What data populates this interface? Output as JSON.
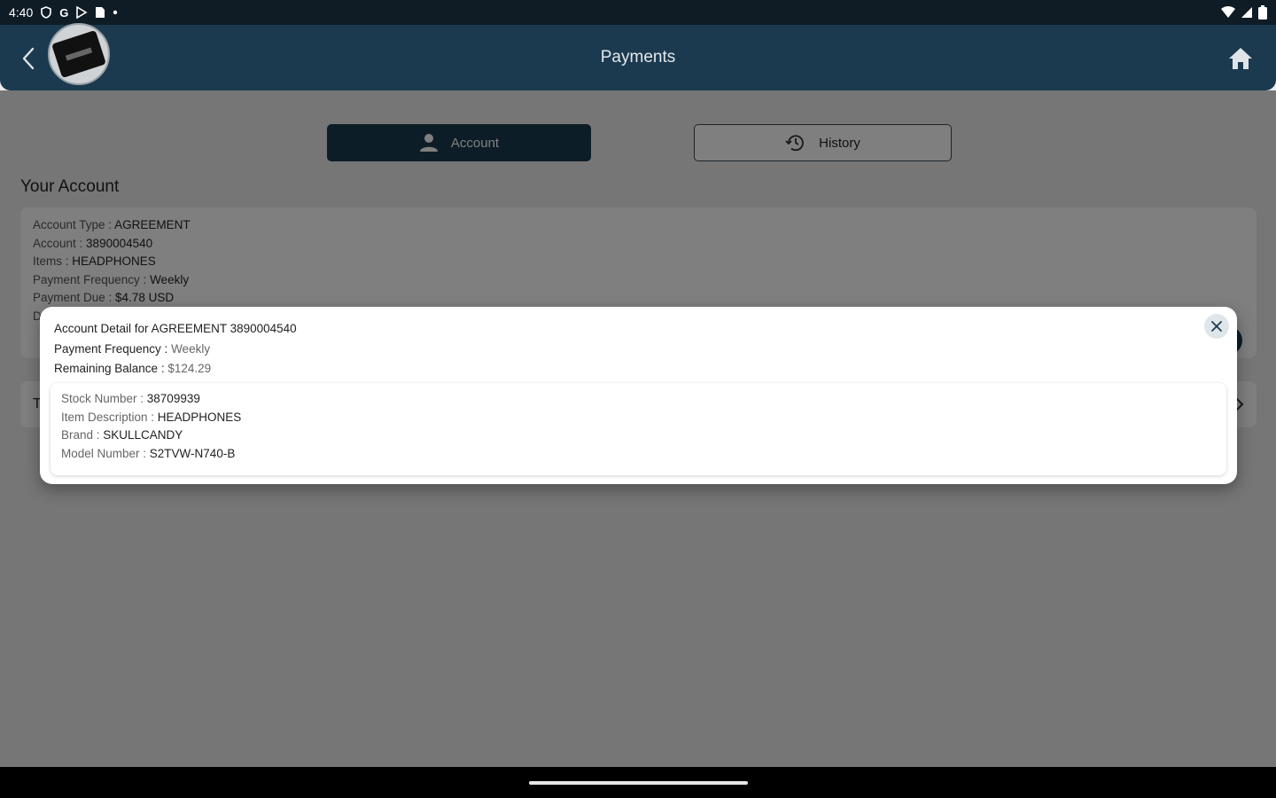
{
  "status_bar": {
    "time": "4:40",
    "glyphs": [
      "G"
    ]
  },
  "header": {
    "title": "Payments"
  },
  "tabs": {
    "account_label": "Account",
    "history_label": "History"
  },
  "section_title": "Your Account",
  "account_card": {
    "rows": [
      {
        "label": "Account Type : ",
        "value": "AGREEMENT"
      },
      {
        "label": "Account : ",
        "value": "3890004540"
      },
      {
        "label": "Items : ",
        "value": "HEADPHONES"
      },
      {
        "label": "Payment Frequency : ",
        "value": "Weekly"
      },
      {
        "label": "Payment Due : ",
        "value": "$4.78 USD"
      },
      {
        "label": "D",
        "value": ""
      }
    ]
  },
  "second_card": {
    "text": "T"
  },
  "modal": {
    "title_label": "Account Detail for ",
    "title_value": "AGREEMENT 3890004540",
    "frequency_label": "Payment Frequency : ",
    "frequency_value": "Weekly",
    "balance_label": "Remaining Balance : ",
    "balance_value": "$124.29",
    "item": {
      "stock_label": "Stock Number : ",
      "stock_value": "38709939",
      "desc_label": "Item Description : ",
      "desc_value": "HEADPHONES",
      "brand_label": "Brand : ",
      "brand_value": "SKULLCANDY",
      "model_label": "Model Number : ",
      "model_value": "S2TVW-N740-B"
    }
  },
  "colors": {
    "primary": "#1b3a4f",
    "status_bar": "#0f1c26",
    "scrim": "rgba(0,0,0,0.5)"
  },
  "icons": {
    "back": "chevron-left-icon",
    "home": "home-icon",
    "account": "person-icon",
    "history": "history-icon",
    "close": "close-icon"
  }
}
